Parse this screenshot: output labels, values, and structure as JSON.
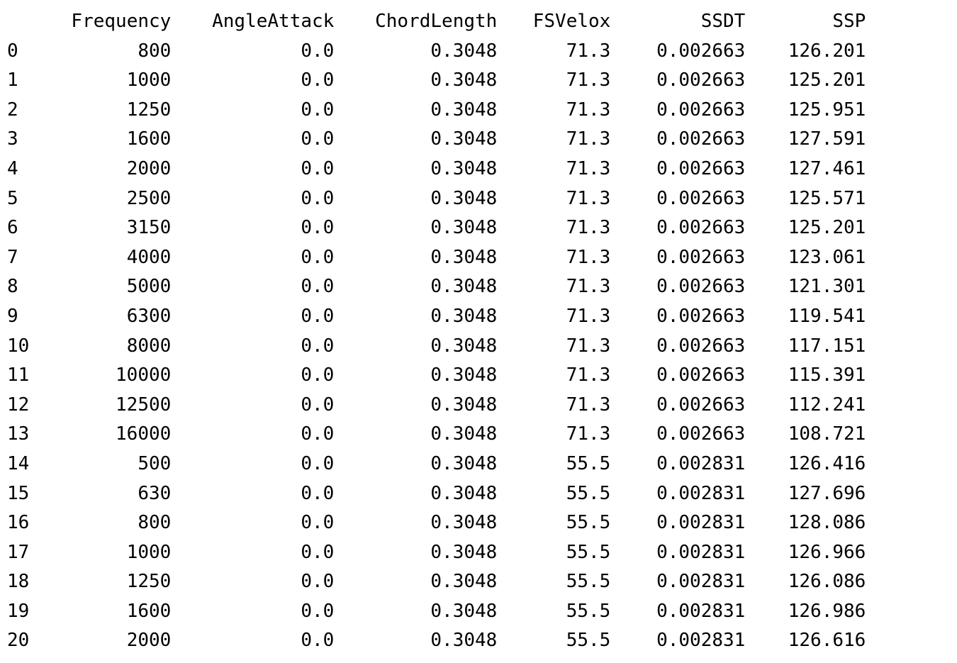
{
  "chart_data": {
    "type": "table",
    "columns": [
      "Frequency",
      "AngleAttack",
      "ChordLength",
      "FSVelox",
      "SSDT",
      "SSP"
    ],
    "index": [
      0,
      1,
      2,
      3,
      4,
      5,
      6,
      7,
      8,
      9,
      10,
      11,
      12,
      13,
      14,
      15,
      16,
      17,
      18,
      19,
      20
    ],
    "rows": [
      {
        "Frequency": 800,
        "AngleAttack": 0.0,
        "ChordLength": 0.3048,
        "FSVelox": 71.3,
        "SSDT": 0.002663,
        "SSP": 126.201
      },
      {
        "Frequency": 1000,
        "AngleAttack": 0.0,
        "ChordLength": 0.3048,
        "FSVelox": 71.3,
        "SSDT": 0.002663,
        "SSP": 125.201
      },
      {
        "Frequency": 1250,
        "AngleAttack": 0.0,
        "ChordLength": 0.3048,
        "FSVelox": 71.3,
        "SSDT": 0.002663,
        "SSP": 125.951
      },
      {
        "Frequency": 1600,
        "AngleAttack": 0.0,
        "ChordLength": 0.3048,
        "FSVelox": 71.3,
        "SSDT": 0.002663,
        "SSP": 127.591
      },
      {
        "Frequency": 2000,
        "AngleAttack": 0.0,
        "ChordLength": 0.3048,
        "FSVelox": 71.3,
        "SSDT": 0.002663,
        "SSP": 127.461
      },
      {
        "Frequency": 2500,
        "AngleAttack": 0.0,
        "ChordLength": 0.3048,
        "FSVelox": 71.3,
        "SSDT": 0.002663,
        "SSP": 125.571
      },
      {
        "Frequency": 3150,
        "AngleAttack": 0.0,
        "ChordLength": 0.3048,
        "FSVelox": 71.3,
        "SSDT": 0.002663,
        "SSP": 125.201
      },
      {
        "Frequency": 4000,
        "AngleAttack": 0.0,
        "ChordLength": 0.3048,
        "FSVelox": 71.3,
        "SSDT": 0.002663,
        "SSP": 123.061
      },
      {
        "Frequency": 5000,
        "AngleAttack": 0.0,
        "ChordLength": 0.3048,
        "FSVelox": 71.3,
        "SSDT": 0.002663,
        "SSP": 121.301
      },
      {
        "Frequency": 6300,
        "AngleAttack": 0.0,
        "ChordLength": 0.3048,
        "FSVelox": 71.3,
        "SSDT": 0.002663,
        "SSP": 119.541
      },
      {
        "Frequency": 8000,
        "AngleAttack": 0.0,
        "ChordLength": 0.3048,
        "FSVelox": 71.3,
        "SSDT": 0.002663,
        "SSP": 117.151
      },
      {
        "Frequency": 10000,
        "AngleAttack": 0.0,
        "ChordLength": 0.3048,
        "FSVelox": 71.3,
        "SSDT": 0.002663,
        "SSP": 115.391
      },
      {
        "Frequency": 12500,
        "AngleAttack": 0.0,
        "ChordLength": 0.3048,
        "FSVelox": 71.3,
        "SSDT": 0.002663,
        "SSP": 112.241
      },
      {
        "Frequency": 16000,
        "AngleAttack": 0.0,
        "ChordLength": 0.3048,
        "FSVelox": 71.3,
        "SSDT": 0.002663,
        "SSP": 108.721
      },
      {
        "Frequency": 500,
        "AngleAttack": 0.0,
        "ChordLength": 0.3048,
        "FSVelox": 55.5,
        "SSDT": 0.002831,
        "SSP": 126.416
      },
      {
        "Frequency": 630,
        "AngleAttack": 0.0,
        "ChordLength": 0.3048,
        "FSVelox": 55.5,
        "SSDT": 0.002831,
        "SSP": 127.696
      },
      {
        "Frequency": 800,
        "AngleAttack": 0.0,
        "ChordLength": 0.3048,
        "FSVelox": 55.5,
        "SSDT": 0.002831,
        "SSP": 128.086
      },
      {
        "Frequency": 1000,
        "AngleAttack": 0.0,
        "ChordLength": 0.3048,
        "FSVelox": 55.5,
        "SSDT": 0.002831,
        "SSP": 126.966
      },
      {
        "Frequency": 1250,
        "AngleAttack": 0.0,
        "ChordLength": 0.3048,
        "FSVelox": 55.5,
        "SSDT": 0.002831,
        "SSP": 126.086
      },
      {
        "Frequency": 1600,
        "AngleAttack": 0.0,
        "ChordLength": 0.3048,
        "FSVelox": 55.5,
        "SSDT": 0.002831,
        "SSP": 126.986
      },
      {
        "Frequency": 2000,
        "AngleAttack": 0.0,
        "ChordLength": 0.3048,
        "FSVelox": 55.5,
        "SSDT": 0.002831,
        "SSP": 126.616
      }
    ]
  },
  "formats": {
    "Frequency": 0,
    "AngleAttack": 1,
    "ChordLength": 4,
    "FSVelox": 1,
    "SSDT": 6,
    "SSP": 3
  },
  "col_classes": [
    "col-freq",
    "col-angle",
    "col-chord",
    "col-fsv",
    "col-ssdt",
    "col-ssp"
  ]
}
